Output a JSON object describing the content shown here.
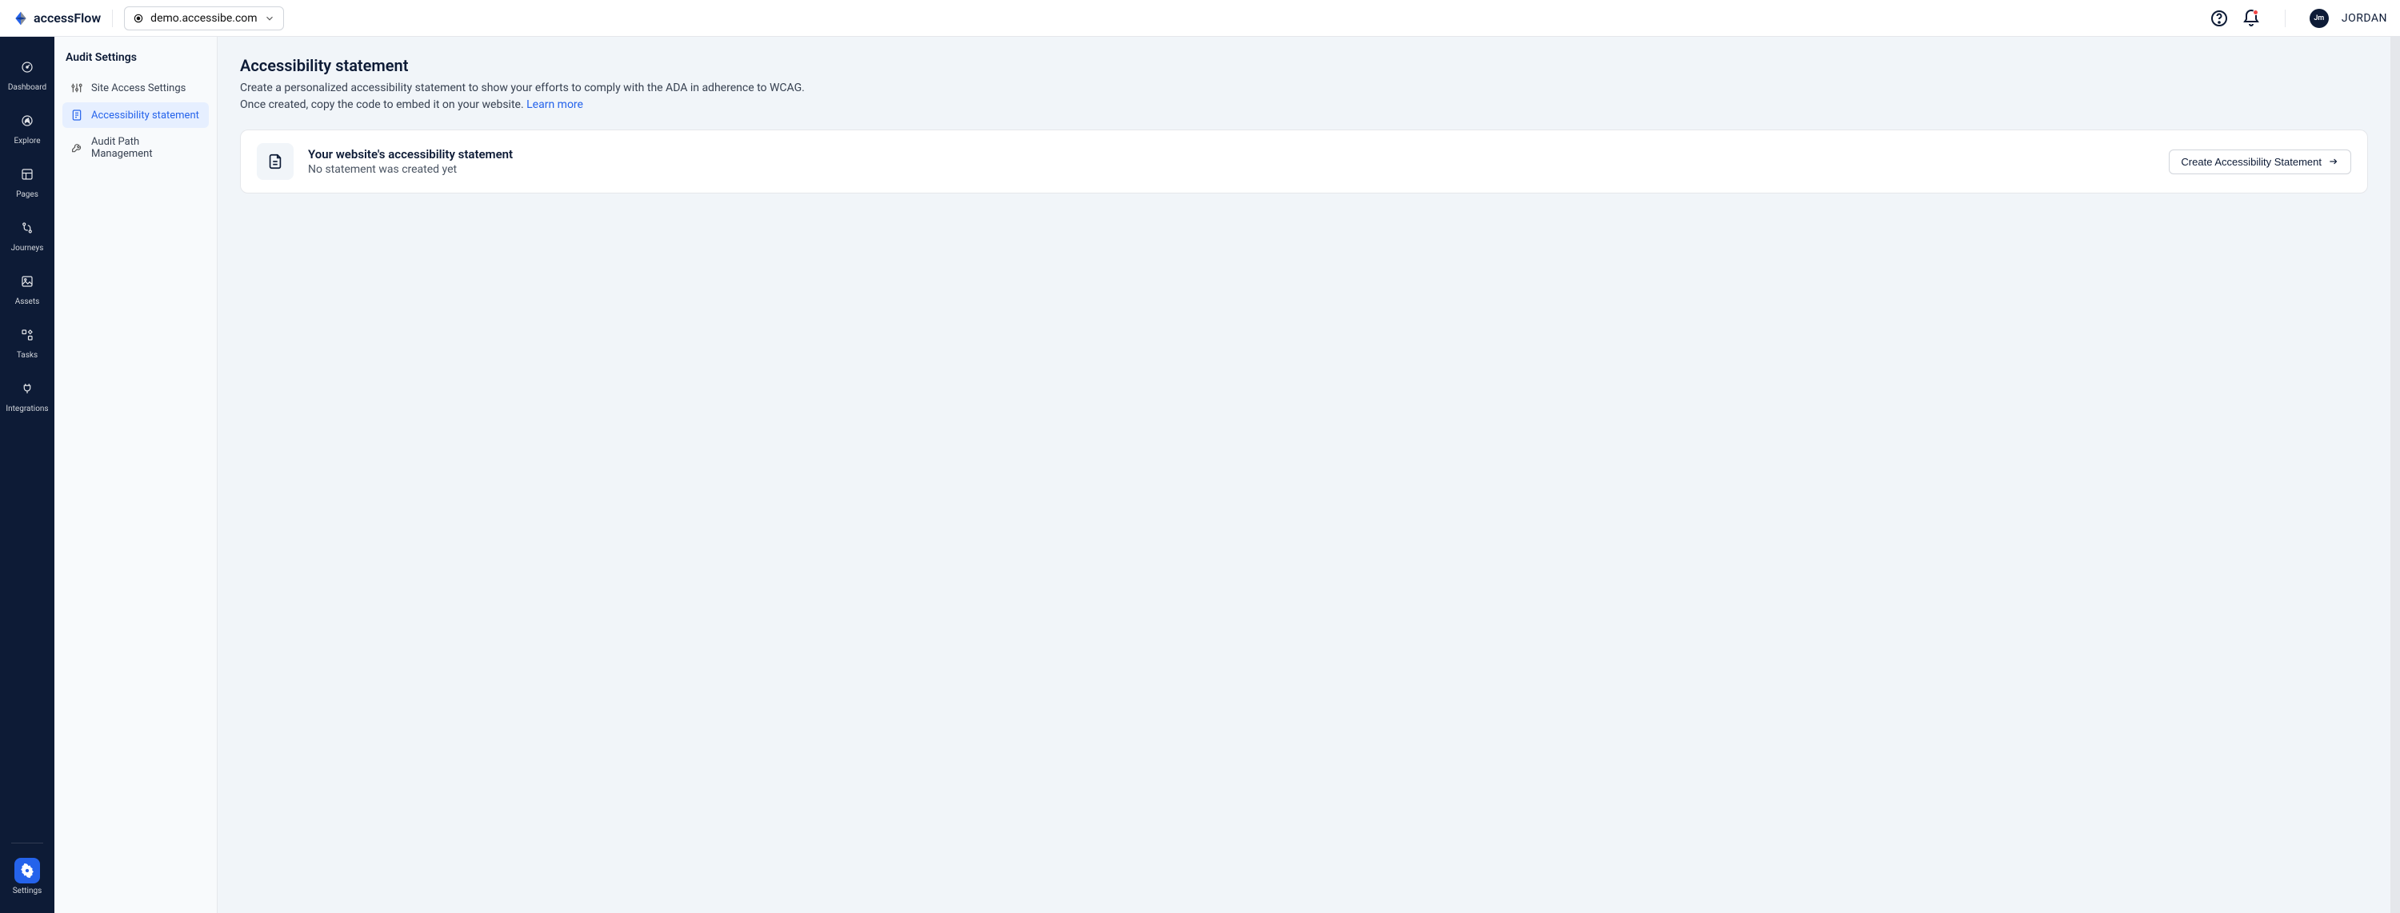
{
  "brand": {
    "name": "accessFlow"
  },
  "header": {
    "domain": "demo.accessibe.com",
    "user": {
      "initials": "Jm",
      "name": "JORDAN"
    }
  },
  "nav_primary": [
    {
      "id": "dashboard",
      "label": "Dashboard",
      "icon": "gauge"
    },
    {
      "id": "explore",
      "label": "Explore",
      "icon": "compass"
    },
    {
      "id": "pages",
      "label": "Pages",
      "icon": "layout"
    },
    {
      "id": "journeys",
      "label": "Journeys",
      "icon": "route"
    },
    {
      "id": "assets",
      "label": "Assets",
      "icon": "image"
    },
    {
      "id": "tasks",
      "label": "Tasks",
      "icon": "widgets"
    },
    {
      "id": "integrations",
      "label": "Integrations",
      "icon": "plug"
    },
    {
      "id": "settings",
      "label": "Settings",
      "icon": "gear",
      "active": true,
      "footer": true
    }
  ],
  "nav_secondary": {
    "title": "Audit Settings",
    "items": [
      {
        "id": "site-access",
        "label": "Site Access Settings",
        "icon": "sliders"
      },
      {
        "id": "a11y-stmt",
        "label": "Accessibility statement",
        "icon": "file",
        "active": true
      },
      {
        "id": "audit-path",
        "label": "Audit Path Management",
        "icon": "tool"
      }
    ]
  },
  "main": {
    "title": "Accessibility statement",
    "description": "Create a personalized accessibility statement to show your efforts to comply with the ADA in adherence to WCAG. Once created, copy the code to embed it on your website. ",
    "learn_more": "Learn more",
    "card": {
      "title": "Your website's accessibility statement",
      "subtitle": "No statement was created yet",
      "button": "Create Accessibility Statement"
    }
  }
}
